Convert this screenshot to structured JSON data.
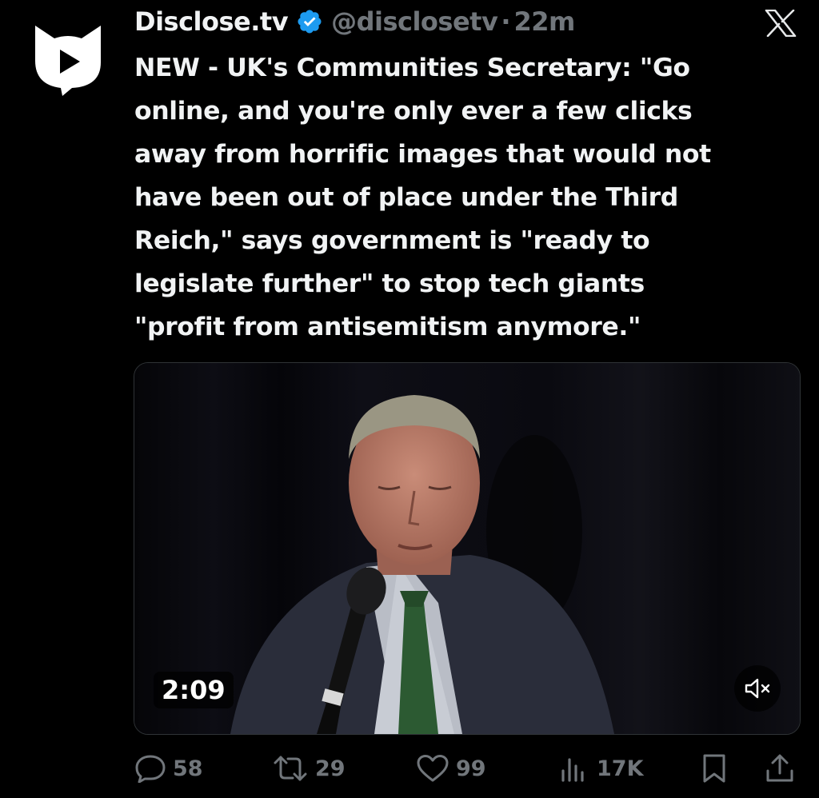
{
  "tweet": {
    "display_name": "Disclose.tv",
    "handle": "@disclosetv",
    "separator": "·",
    "time": "22m",
    "text": "NEW - UK's Communities Secretary: \"Go\nonline, and you're only ever a few clicks\naway from horrific images that would not\nhave been out of place under the Third\nReich,\" says government is \"ready to\nlegislate further\" to stop tech giants\n\"profit from antisemitism anymore.\""
  },
  "media": {
    "type": "video",
    "duration": "2:09",
    "muted": true
  },
  "actions": {
    "replies": "58",
    "reposts": "29",
    "likes": "99",
    "views": "17K"
  },
  "icons": {
    "avatar": "disclose-cat-play-icon",
    "verified": "verified-badge-icon",
    "platform": "x-logo-icon",
    "reply": "reply-icon",
    "repost": "repost-icon",
    "like": "heart-icon",
    "views": "views-bar-chart-icon",
    "bookmark": "bookmark-icon",
    "share": "share-icon",
    "mute": "speaker-muted-icon"
  },
  "colors": {
    "background": "#000000",
    "text": "#f1f3f4",
    "secondary": "#71767b",
    "verified": "#1d9bf0",
    "avatar_bg": "#ffffff"
  }
}
